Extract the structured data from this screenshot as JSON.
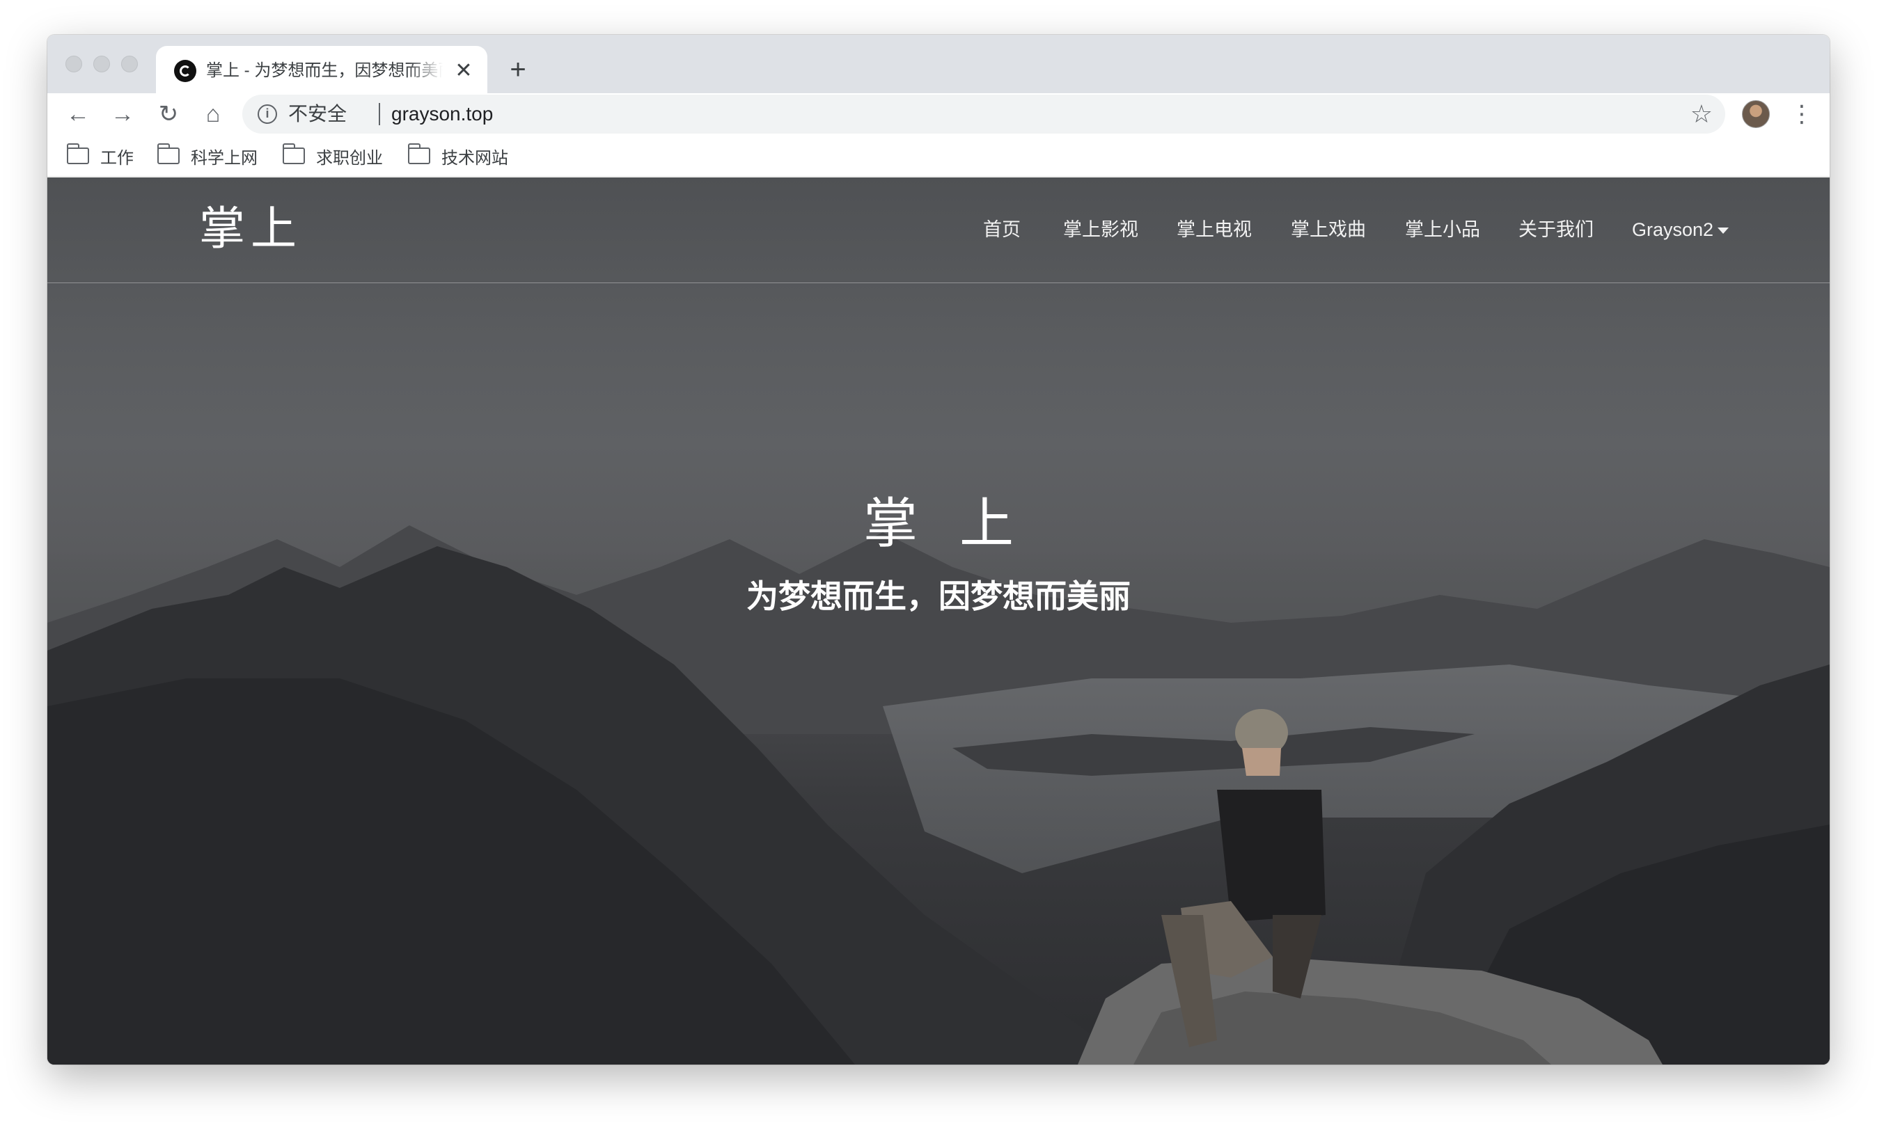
{
  "browser": {
    "tab": {
      "title": "掌上 - 为梦想而生，因梦想而美丽",
      "close": "✕"
    },
    "new_tab": "+",
    "toolbar": {
      "back": "←",
      "forward": "→",
      "reload": "↻",
      "home": "⌂",
      "security_label": "不安全",
      "url": "grayson.top",
      "bookmark_star": "☆",
      "menu": "⋮"
    },
    "bookmarks": [
      {
        "label": "工作"
      },
      {
        "label": "科学上网"
      },
      {
        "label": "求职创业"
      },
      {
        "label": "技术网站"
      }
    ]
  },
  "site": {
    "logo": "掌上",
    "nav": [
      {
        "label": "首页"
      },
      {
        "label": "掌上影视"
      },
      {
        "label": "掌上电视"
      },
      {
        "label": "掌上戏曲"
      },
      {
        "label": "掌上小品"
      },
      {
        "label": "关于我们"
      },
      {
        "label": "Grayson2"
      }
    ],
    "hero": {
      "title": "掌上",
      "subtitle": "为梦想而生，因梦想而美丽"
    }
  },
  "icons": {
    "info": "info-icon",
    "star": "star-icon",
    "folder": "folder-icon"
  }
}
